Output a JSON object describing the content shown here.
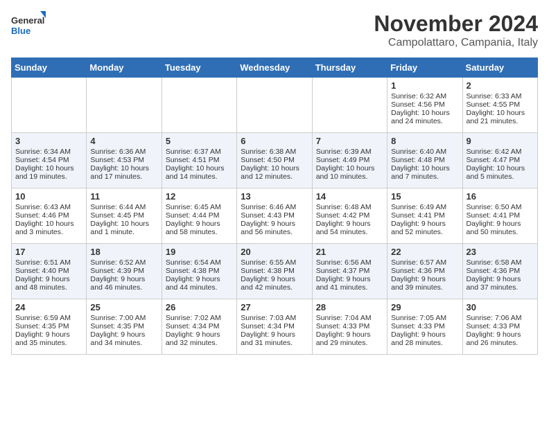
{
  "logo": {
    "line1": "General",
    "line2": "Blue"
  },
  "title": "November 2024",
  "location": "Campolattaro, Campania, Italy",
  "days_of_week": [
    "Sunday",
    "Monday",
    "Tuesday",
    "Wednesday",
    "Thursday",
    "Friday",
    "Saturday"
  ],
  "weeks": [
    [
      {
        "day": "",
        "content": ""
      },
      {
        "day": "",
        "content": ""
      },
      {
        "day": "",
        "content": ""
      },
      {
        "day": "",
        "content": ""
      },
      {
        "day": "",
        "content": ""
      },
      {
        "day": "1",
        "content": "Sunrise: 6:32 AM\nSunset: 4:56 PM\nDaylight: 10 hours and 24 minutes."
      },
      {
        "day": "2",
        "content": "Sunrise: 6:33 AM\nSunset: 4:55 PM\nDaylight: 10 hours and 21 minutes."
      }
    ],
    [
      {
        "day": "3",
        "content": "Sunrise: 6:34 AM\nSunset: 4:54 PM\nDaylight: 10 hours and 19 minutes."
      },
      {
        "day": "4",
        "content": "Sunrise: 6:36 AM\nSunset: 4:53 PM\nDaylight: 10 hours and 17 minutes."
      },
      {
        "day": "5",
        "content": "Sunrise: 6:37 AM\nSunset: 4:51 PM\nDaylight: 10 hours and 14 minutes."
      },
      {
        "day": "6",
        "content": "Sunrise: 6:38 AM\nSunset: 4:50 PM\nDaylight: 10 hours and 12 minutes."
      },
      {
        "day": "7",
        "content": "Sunrise: 6:39 AM\nSunset: 4:49 PM\nDaylight: 10 hours and 10 minutes."
      },
      {
        "day": "8",
        "content": "Sunrise: 6:40 AM\nSunset: 4:48 PM\nDaylight: 10 hours and 7 minutes."
      },
      {
        "day": "9",
        "content": "Sunrise: 6:42 AM\nSunset: 4:47 PM\nDaylight: 10 hours and 5 minutes."
      }
    ],
    [
      {
        "day": "10",
        "content": "Sunrise: 6:43 AM\nSunset: 4:46 PM\nDaylight: 10 hours and 3 minutes."
      },
      {
        "day": "11",
        "content": "Sunrise: 6:44 AM\nSunset: 4:45 PM\nDaylight: 10 hours and 1 minute."
      },
      {
        "day": "12",
        "content": "Sunrise: 6:45 AM\nSunset: 4:44 PM\nDaylight: 9 hours and 58 minutes."
      },
      {
        "day": "13",
        "content": "Sunrise: 6:46 AM\nSunset: 4:43 PM\nDaylight: 9 hours and 56 minutes."
      },
      {
        "day": "14",
        "content": "Sunrise: 6:48 AM\nSunset: 4:42 PM\nDaylight: 9 hours and 54 minutes."
      },
      {
        "day": "15",
        "content": "Sunrise: 6:49 AM\nSunset: 4:41 PM\nDaylight: 9 hours and 52 minutes."
      },
      {
        "day": "16",
        "content": "Sunrise: 6:50 AM\nSunset: 4:41 PM\nDaylight: 9 hours and 50 minutes."
      }
    ],
    [
      {
        "day": "17",
        "content": "Sunrise: 6:51 AM\nSunset: 4:40 PM\nDaylight: 9 hours and 48 minutes."
      },
      {
        "day": "18",
        "content": "Sunrise: 6:52 AM\nSunset: 4:39 PM\nDaylight: 9 hours and 46 minutes."
      },
      {
        "day": "19",
        "content": "Sunrise: 6:54 AM\nSunset: 4:38 PM\nDaylight: 9 hours and 44 minutes."
      },
      {
        "day": "20",
        "content": "Sunrise: 6:55 AM\nSunset: 4:38 PM\nDaylight: 9 hours and 42 minutes."
      },
      {
        "day": "21",
        "content": "Sunrise: 6:56 AM\nSunset: 4:37 PM\nDaylight: 9 hours and 41 minutes."
      },
      {
        "day": "22",
        "content": "Sunrise: 6:57 AM\nSunset: 4:36 PM\nDaylight: 9 hours and 39 minutes."
      },
      {
        "day": "23",
        "content": "Sunrise: 6:58 AM\nSunset: 4:36 PM\nDaylight: 9 hours and 37 minutes."
      }
    ],
    [
      {
        "day": "24",
        "content": "Sunrise: 6:59 AM\nSunset: 4:35 PM\nDaylight: 9 hours and 35 minutes."
      },
      {
        "day": "25",
        "content": "Sunrise: 7:00 AM\nSunset: 4:35 PM\nDaylight: 9 hours and 34 minutes."
      },
      {
        "day": "26",
        "content": "Sunrise: 7:02 AM\nSunset: 4:34 PM\nDaylight: 9 hours and 32 minutes."
      },
      {
        "day": "27",
        "content": "Sunrise: 7:03 AM\nSunset: 4:34 PM\nDaylight: 9 hours and 31 minutes."
      },
      {
        "day": "28",
        "content": "Sunrise: 7:04 AM\nSunset: 4:33 PM\nDaylight: 9 hours and 29 minutes."
      },
      {
        "day": "29",
        "content": "Sunrise: 7:05 AM\nSunset: 4:33 PM\nDaylight: 9 hours and 28 minutes."
      },
      {
        "day": "30",
        "content": "Sunrise: 7:06 AM\nSunset: 4:33 PM\nDaylight: 9 hours and 26 minutes."
      }
    ]
  ]
}
